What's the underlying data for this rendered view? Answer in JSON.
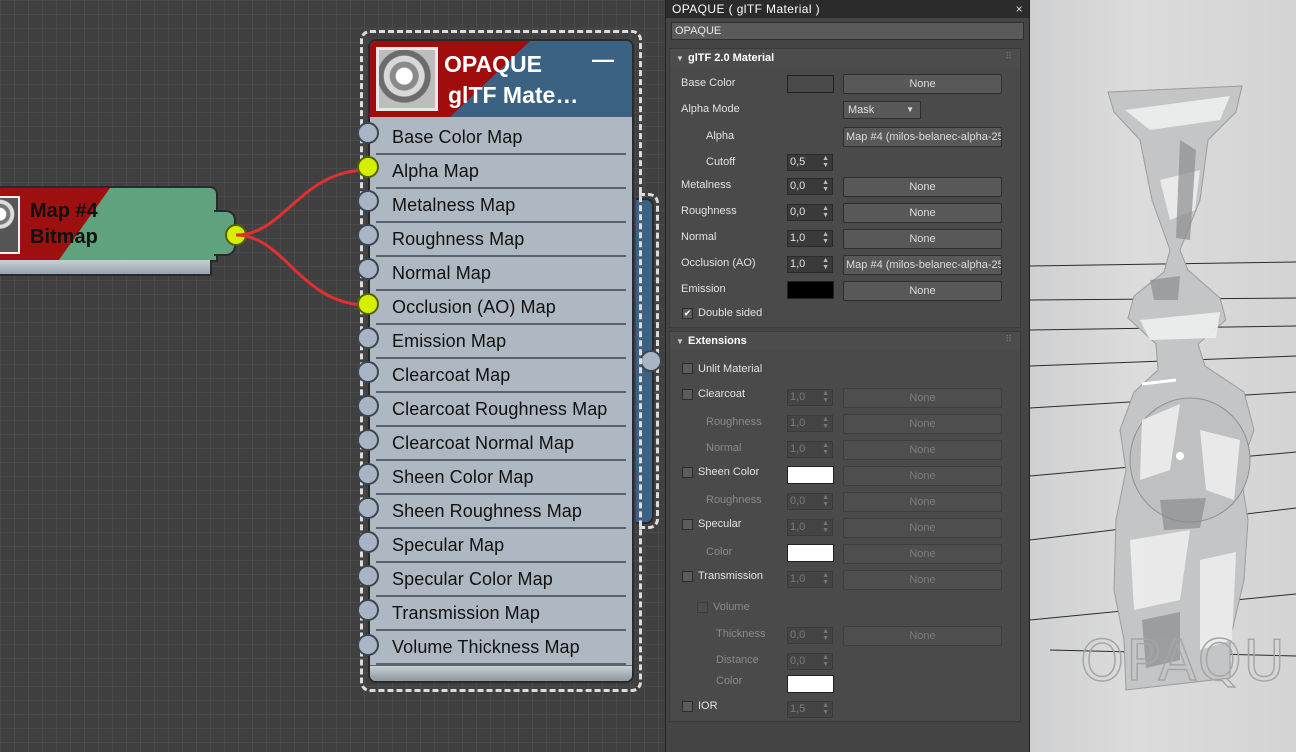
{
  "node_editor": {
    "bitmap_node": {
      "title_line1": "Map #4",
      "title_line2": "Bitmap"
    },
    "material_node": {
      "title_line1": "OPAQUE",
      "title_line2": "glTF Mate…",
      "minimize_glyph": "—",
      "maps": [
        {
          "label": "Base Color Map",
          "connected": false
        },
        {
          "label": "Alpha Map",
          "connected": true
        },
        {
          "label": "Metalness Map",
          "connected": false
        },
        {
          "label": "Roughness Map",
          "connected": false
        },
        {
          "label": "Normal Map",
          "connected": false
        },
        {
          "label": "Occlusion (AO) Map",
          "connected": true
        },
        {
          "label": "Emission Map",
          "connected": false
        },
        {
          "label": "Clearcoat Map",
          "connected": false
        },
        {
          "label": "Clearcoat Roughness Map",
          "connected": false
        },
        {
          "label": "Clearcoat Normal Map",
          "connected": false
        },
        {
          "label": "Sheen Color Map",
          "connected": false
        },
        {
          "label": "Sheen Roughness Map",
          "connected": false
        },
        {
          "label": "Specular Map",
          "connected": false
        },
        {
          "label": "Specular Color Map",
          "connected": false
        },
        {
          "label": "Transmission Map",
          "connected": false
        },
        {
          "label": "Volume Thickness Map",
          "connected": false
        }
      ]
    }
  },
  "panel": {
    "title": "OPAQUE  ( glTF Material )",
    "close_glyph": "×",
    "material_name": "OPAQUE",
    "gltf": {
      "header": "glTF 2.0 Material",
      "base_color": {
        "label": "Base Color",
        "swatch": "#ffffff",
        "map": "None"
      },
      "alpha_mode": {
        "label": "Alpha Mode",
        "value": "Mask"
      },
      "alpha": {
        "label": "Alpha",
        "map": "Map #4 (milos-belanec-alpha-25-"
      },
      "cutoff": {
        "label": "Cutoff",
        "value": "0,5"
      },
      "metalness": {
        "label": "Metalness",
        "value": "0,0",
        "map": "None"
      },
      "roughness": {
        "label": "Roughness",
        "value": "0,0",
        "map": "None"
      },
      "normal": {
        "label": "Normal",
        "value": "1,0",
        "map": "None"
      },
      "occlusion": {
        "label": "Occlusion (AO)",
        "value": "1,0",
        "map": "Map #4 (milos-belanec-alpha-25-"
      },
      "emission": {
        "label": "Emission",
        "swatch": "#000000",
        "map": "None"
      },
      "double_sided": {
        "label": "Double sided",
        "checked": true,
        "check_glyph": "✔"
      }
    },
    "extensions": {
      "header": "Extensions",
      "unlit": {
        "label": "Unlit Material"
      },
      "clearcoat": {
        "label": "Clearcoat",
        "value": "1,0",
        "map": "None"
      },
      "cc_roughness": {
        "label": "Roughness",
        "value": "1,0",
        "map": "None"
      },
      "cc_normal": {
        "label": "Normal",
        "value": "1,0",
        "map": "None"
      },
      "sheen_color": {
        "label": "Sheen Color",
        "swatch": "#ffffff",
        "map": "None"
      },
      "sheen_roughness": {
        "label": "Roughness",
        "value": "0,0",
        "map": "None"
      },
      "specular": {
        "label": "Specular",
        "value": "1,0",
        "map": "None"
      },
      "spec_color": {
        "label": "Color",
        "swatch": "#ffffff",
        "map": "None"
      },
      "transmission": {
        "label": "Transmission",
        "value": "1,0",
        "map": "None"
      },
      "volume": {
        "label": "Volume"
      },
      "thickness": {
        "label": "Thickness",
        "value": "0,0",
        "map": "None"
      },
      "distance": {
        "label": "Distance",
        "value": "0,0"
      },
      "vol_color": {
        "label": "Color",
        "swatch": "#ffffff"
      },
      "ior": {
        "label": "IOR",
        "value": "1,5"
      }
    }
  },
  "viewport": {
    "watermark": "OPAQU"
  },
  "colors": {
    "socket_active": "#d4f000",
    "socket_idle": "#a9b5c4",
    "wire": "#e03030",
    "node_header_blue": "#3b6183",
    "node_header_red": "#a00b0b",
    "bitmap_green": "#5fa27d"
  }
}
